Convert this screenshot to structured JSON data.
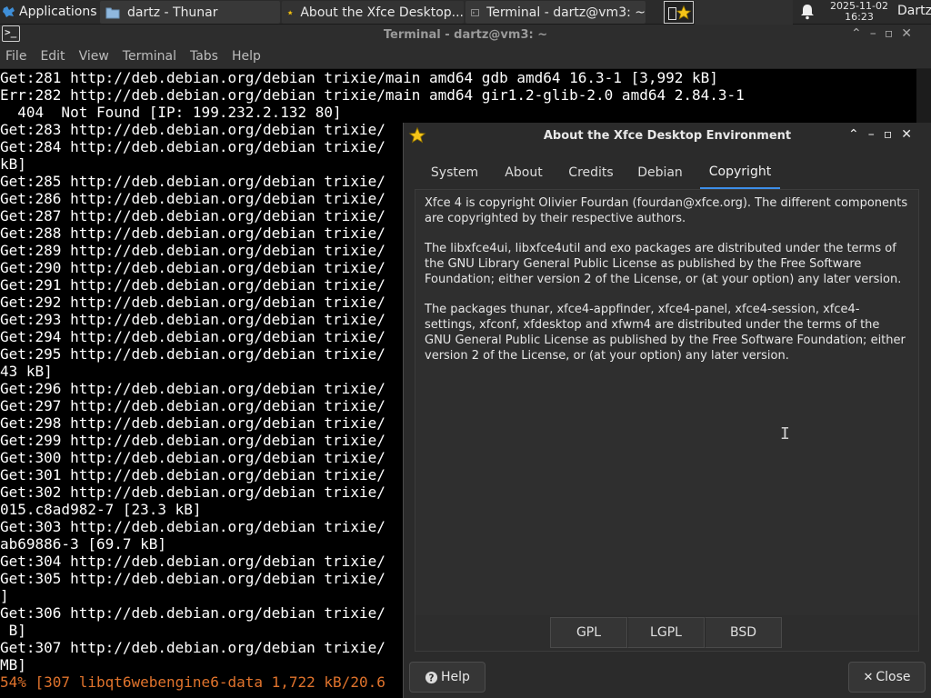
{
  "panel": {
    "apps_label": "Applications",
    "tasks": [
      {
        "label": "dartz - Thunar",
        "icon": "folder-icon"
      },
      {
        "label": "About the Xfce Desktop...",
        "icon": "star-icon"
      },
      {
        "label": "Terminal - dartz@vm3: ~",
        "icon": "terminal-icon"
      }
    ],
    "clock_date": "2025-11-02",
    "clock_time": "16:23",
    "user": "Dartz"
  },
  "terminal": {
    "title": "Terminal - dartz@vm3: ~",
    "menu": [
      "File",
      "Edit",
      "View",
      "Terminal",
      "Tabs",
      "Help"
    ],
    "lines": [
      "Get:281 http://deb.debian.org/debian trixie/main amd64 gdb amd64 16.3-1 [3,992 kB]",
      "Err:282 http://deb.debian.org/debian trixie/main amd64 gir1.2-glib-2.0 amd64 2.84.3-1",
      "  404  Not Found [IP: 199.232.2.132 80]",
      "Get:283 http://deb.debian.org/debian trixie/",
      "Get:284 http://deb.debian.org/debian trixie/",
      "kB]",
      "Get:285 http://deb.debian.org/debian trixie/",
      "Get:286 http://deb.debian.org/debian trixie/",
      "Get:287 http://deb.debian.org/debian trixie/",
      "Get:288 http://deb.debian.org/debian trixie/",
      "Get:289 http://deb.debian.org/debian trixie/",
      "Get:290 http://deb.debian.org/debian trixie/",
      "Get:291 http://deb.debian.org/debian trixie/",
      "Get:292 http://deb.debian.org/debian trixie/",
      "Get:293 http://deb.debian.org/debian trixie/",
      "Get:294 http://deb.debian.org/debian trixie/",
      "Get:295 http://deb.debian.org/debian trixie/",
      "43 kB]",
      "Get:296 http://deb.debian.org/debian trixie/",
      "Get:297 http://deb.debian.org/debian trixie/",
      "Get:298 http://deb.debian.org/debian trixie/",
      "Get:299 http://deb.debian.org/debian trixie/",
      "Get:300 http://deb.debian.org/debian trixie/",
      "Get:301 http://deb.debian.org/debian trixie/",
      "Get:302 http://deb.debian.org/debian trixie/",
      "015.c8ad982-7 [23.3 kB]",
      "Get:303 http://deb.debian.org/debian trixie/",
      "ab69886-3 [69.7 kB]",
      "Get:304 http://deb.debian.org/debian trixie/",
      "Get:305 http://deb.debian.org/debian trixie/",
      "]",
      "Get:306 http://deb.debian.org/debian trixie/",
      " B]",
      "Get:307 http://deb.debian.org/debian trixie/",
      "MB]"
    ],
    "progress_line": "54% [307 libqt6webengine6-data 1,722 kB/20.6"
  },
  "about": {
    "title": "About the Xfce Desktop Environment",
    "tabs": [
      "System",
      "About",
      "Credits",
      "Debian",
      "Copyright"
    ],
    "active_tab": "Copyright",
    "paragraphs": [
      "Xfce 4 is copyright Olivier Fourdan (fourdan@xfce.org). The different components are copyrighted by their respective authors.",
      "The libxfce4ui, libxfce4util and exo packages are distributed under the terms of the GNU Library General Public License as published by the Free Software Foundation; either version 2 of the License, or (at your option) any later version.",
      "The packages thunar, xfce4-appfinder, xfce4-panel, xfce4-session, xfce4-settings, xfconf, xfdesktop and xfwm4 are distributed under the terms of the GNU General Public License as published by the Free Software Foundation; either version 2 of the License, or (at your option) any later version."
    ],
    "license_buttons": [
      "GPL",
      "LGPL",
      "BSD"
    ],
    "help_label": "Help",
    "close_label": "Close"
  },
  "colors": {
    "accent": "#3d8ee8",
    "progress_text": "#e0732c",
    "star": "#f5c518"
  }
}
